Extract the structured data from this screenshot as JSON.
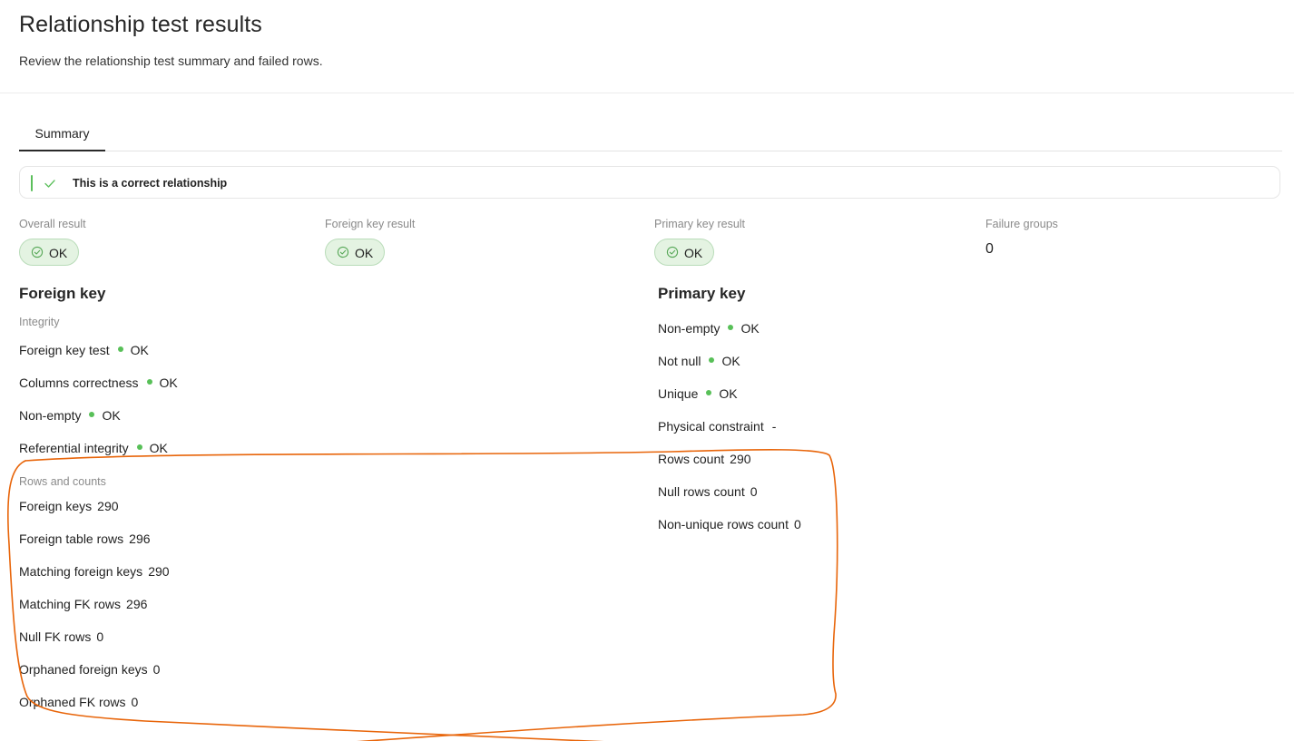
{
  "header": {
    "title": "Relationship test results",
    "subtitle": "Review the relationship test summary and failed rows."
  },
  "tabs": [
    {
      "label": "Summary"
    }
  ],
  "alert": {
    "text": "This is a correct relationship"
  },
  "results": {
    "overall": {
      "label": "Overall result",
      "value": "OK"
    },
    "foreign_key": {
      "label": "Foreign key result",
      "value": "OK"
    },
    "primary_key": {
      "label": "Primary key result",
      "value": "OK"
    },
    "failure_groups": {
      "label": "Failure groups",
      "value": "0"
    }
  },
  "foreign_key": {
    "title": "Foreign key",
    "integrity_label": "Integrity",
    "integrity": [
      {
        "label": "Foreign key test",
        "status": "OK"
      },
      {
        "label": "Columns correctness",
        "status": "OK"
      },
      {
        "label": "Non-empty",
        "status": "OK"
      },
      {
        "label": "Referential integrity",
        "status": "OK"
      }
    ],
    "counts_label": "Rows and counts",
    "counts": [
      {
        "label": "Foreign keys",
        "value": "290"
      },
      {
        "label": "Foreign table rows",
        "value": "296"
      },
      {
        "label": "Matching foreign keys",
        "value": "290"
      },
      {
        "label": "Matching FK rows",
        "value": "296"
      },
      {
        "label": "Null FK rows",
        "value": "0"
      },
      {
        "label": "Orphaned foreign keys",
        "value": "0"
      },
      {
        "label": "Orphaned FK rows",
        "value": "0"
      }
    ]
  },
  "primary_key": {
    "title": "Primary key",
    "checks": [
      {
        "label": "Non-empty",
        "status": "OK"
      },
      {
        "label": "Not null",
        "status": "OK"
      },
      {
        "label": "Unique",
        "status": "OK"
      }
    ],
    "physical_constraint": {
      "label": "Physical constraint",
      "value": "-"
    },
    "counts": [
      {
        "label": "Rows count",
        "value": "290"
      },
      {
        "label": "Null rows count",
        "value": "0"
      },
      {
        "label": "Non-unique rows count",
        "value": "0"
      }
    ]
  },
  "colors": {
    "ok_green": "#58c058",
    "pill_background": "#e4f3e2",
    "annotation_orange": "#e8650a"
  }
}
